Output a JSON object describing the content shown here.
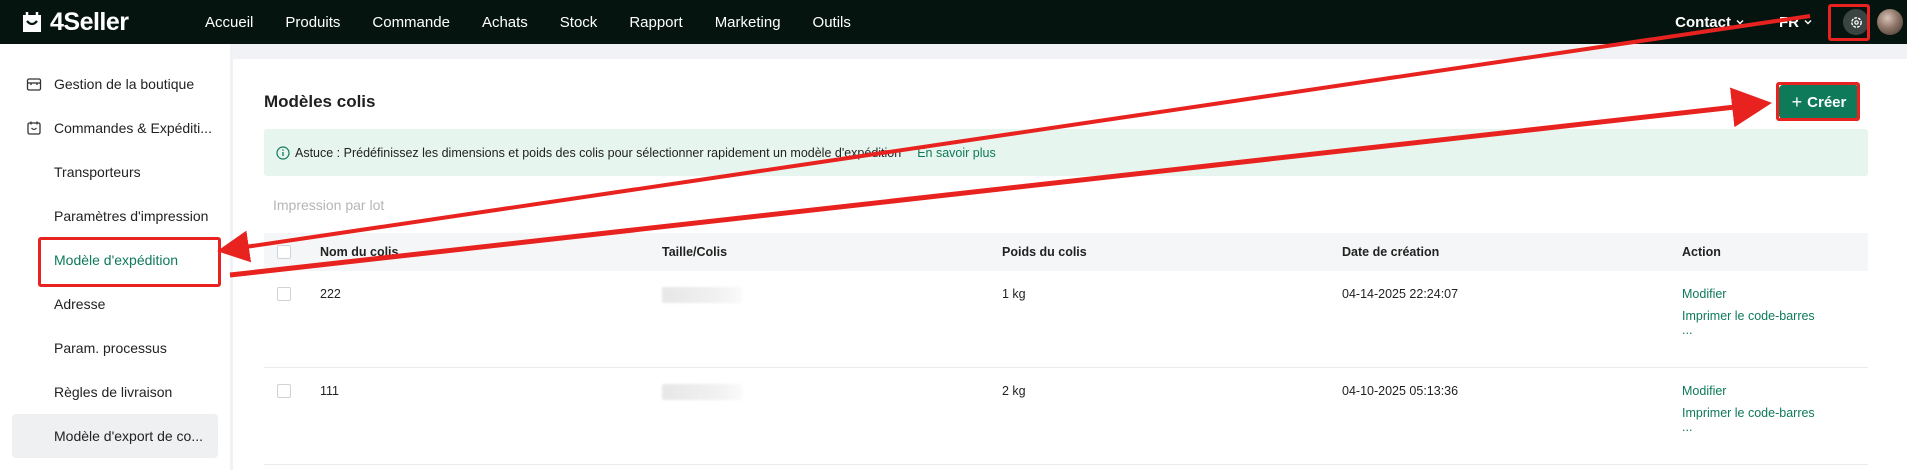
{
  "app": {
    "brand": "4Seller"
  },
  "nav": [
    "Accueil",
    "Produits",
    "Commande",
    "Achats",
    "Stock",
    "Rapport",
    "Marketing",
    "Outils"
  ],
  "header": {
    "contact": "Contact",
    "lang": "FR"
  },
  "sidebar": {
    "parents": [
      "Gestion de la boutique",
      "Commandes & Expéditi..."
    ],
    "children": [
      "Transporteurs",
      "Paramètres d'impression",
      "Modèle d'expédition",
      "Adresse",
      "Param. processus",
      "Règles de livraison",
      "Modèle d'export de co..."
    ]
  },
  "main": {
    "title": "Modèles colis",
    "create_label": "Créer",
    "create_plus": "+",
    "tip_text": "Astuce : Prédéfinissez les dimensions et poids des colis pour sélectionner rapidement un modèle d'expédition",
    "tip_link": "En savoir plus",
    "batch": "Impression par lot"
  },
  "table": {
    "columns": [
      "Nom du colis",
      "Taille/Colis",
      "Poids du colis",
      "Date de création",
      "Action"
    ],
    "rows": [
      {
        "name": "222",
        "weight": "1 kg",
        "date": "04-14-2025 22:24:07"
      },
      {
        "name": "111",
        "weight": "2 kg",
        "date": "04-10-2025 05:13:36"
      }
    ],
    "actions": {
      "modify": "Modifier",
      "print": "Imprimer le code-barres",
      "more": "..."
    }
  },
  "colors": {
    "accent": "#0e7a5a",
    "topbar": "#06140f",
    "annotation": "#e8231f"
  }
}
